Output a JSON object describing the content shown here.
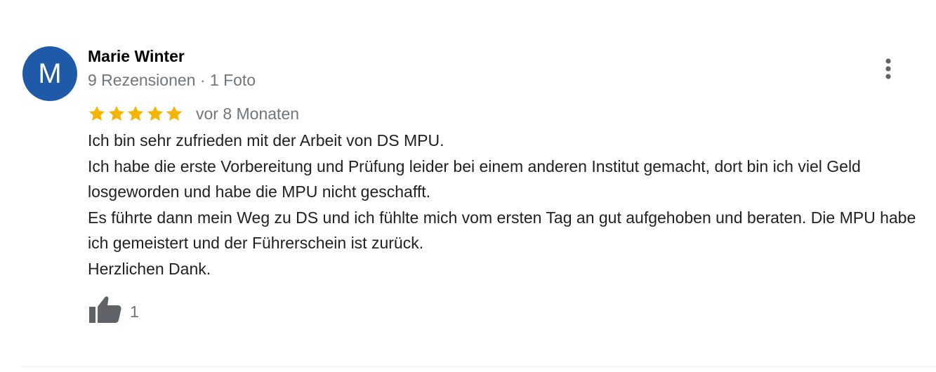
{
  "review": {
    "avatar_letter": "M",
    "avatar_color": "#1f5aa8",
    "author_name": "Marie Winter",
    "author_meta": "9 Rezensionen · 1 Foto",
    "rating": 5,
    "rating_max": 5,
    "star_color": "#f4b400",
    "date": "vor 8 Monaten",
    "text_lines": [
      "Ich bin sehr zufrieden mit der Arbeit von DS MPU.",
      "Ich habe die erste Vorbereitung und Prüfung leider bei einem anderen Institut gemacht, dort bin ich viel Geld losgeworden und habe die MPU nicht geschafft.",
      "Es führte dann mein Weg zu DS und ich fühlte mich vom ersten Tag an gut aufgehoben und beraten. Die MPU habe ich gemeistert und der Führerschein ist zurück.",
      "Herzlichen Dank."
    ],
    "like_count": "1",
    "icons": {
      "more": "more-vert-icon",
      "like": "thumb-up-icon",
      "star": "star-icon"
    }
  }
}
